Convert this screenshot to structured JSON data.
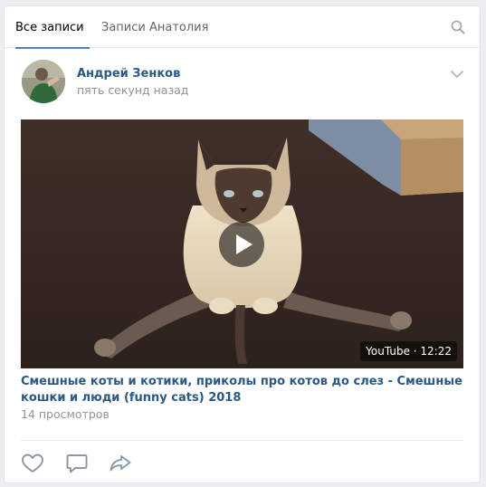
{
  "tabs": [
    {
      "label": "Все записи",
      "active": true
    },
    {
      "label": "Записи Анатолия",
      "active": false
    }
  ],
  "post": {
    "author": "Андрей Зенков",
    "time": "пять секунд назад",
    "video": {
      "source": "YouTube",
      "duration": "12:22",
      "badge": "YouTube · 12:22",
      "title": "Смешные коты и котики, приколы про котов до слез - Смешные кошки и люди (funny cats) 2018"
    },
    "views": "14 просмотров"
  },
  "icons": {
    "search": "search-icon",
    "menu": "chevron-down-icon",
    "like": "heart-icon",
    "comment": "comment-icon",
    "share": "share-arrow-icon",
    "play": "play-icon"
  },
  "colors": {
    "link": "#2a5885",
    "accent": "#5181b8",
    "muted": "#939393",
    "background": "#edeef0"
  }
}
